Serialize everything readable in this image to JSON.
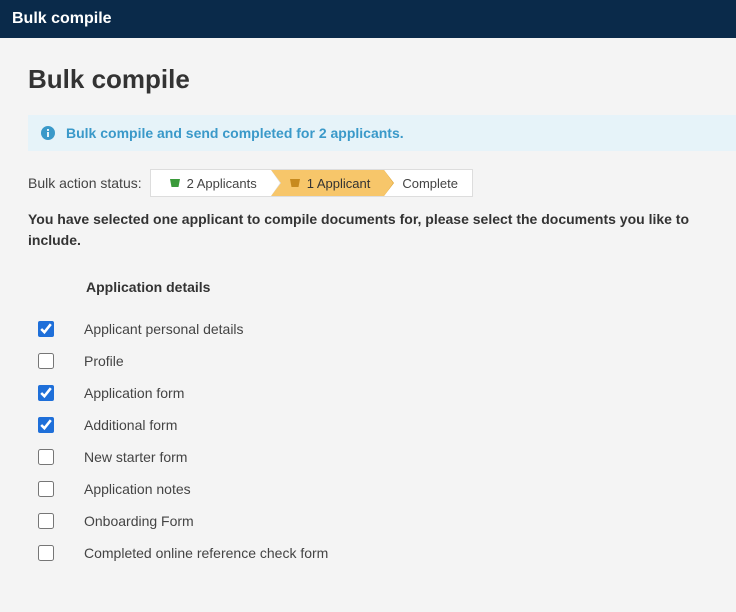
{
  "topbar": {
    "title": "Bulk compile"
  },
  "page": {
    "title": "Bulk compile"
  },
  "alert": {
    "message": "Bulk compile and send completed for 2 applicants."
  },
  "status": {
    "label": "Bulk action status:",
    "crumbs": [
      {
        "label": "2 Applicants",
        "icon": "bucket-green",
        "active": false
      },
      {
        "label": "1 Applicant",
        "icon": "bucket-orange",
        "active": true
      },
      {
        "label": "Complete",
        "icon": null,
        "active": false
      }
    ]
  },
  "instruction": "You have selected one applicant to compile documents for, please select the documents you like to include.",
  "section": {
    "header": "Application details"
  },
  "documents": [
    {
      "label": "Applicant personal details",
      "checked": true
    },
    {
      "label": "Profile",
      "checked": false
    },
    {
      "label": "Application form",
      "checked": true
    },
    {
      "label": "Additional form",
      "checked": true
    },
    {
      "label": "New starter form",
      "checked": false
    },
    {
      "label": "Application notes",
      "checked": false
    },
    {
      "label": "Onboarding Form",
      "checked": false
    },
    {
      "label": "Completed online reference check form",
      "checked": false
    }
  ]
}
